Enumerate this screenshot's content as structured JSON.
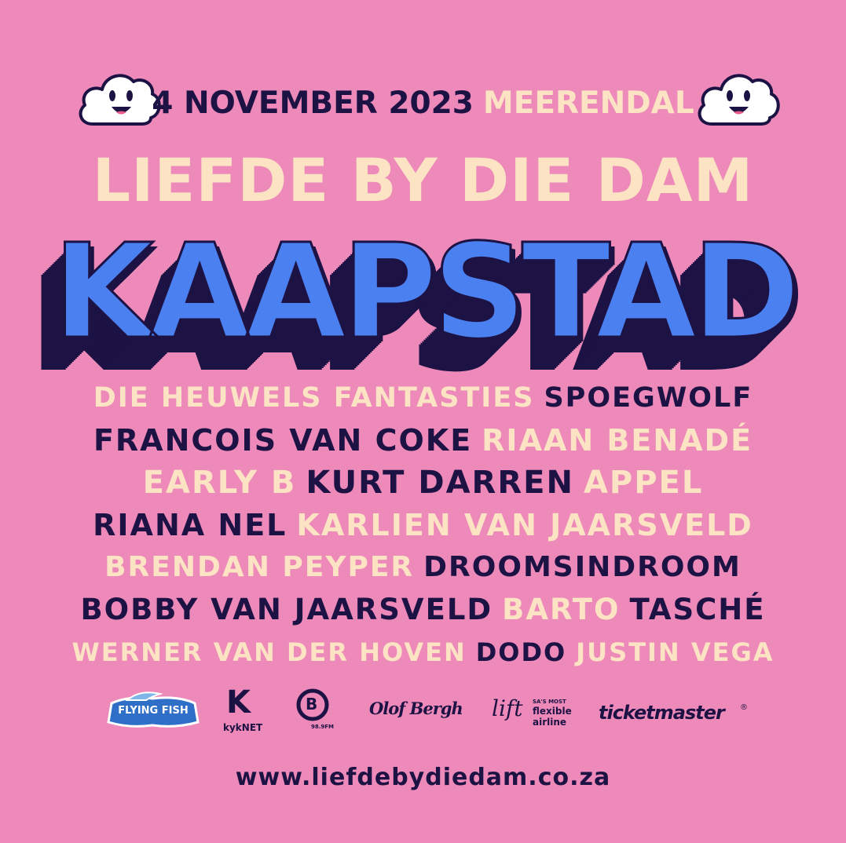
{
  "header": {
    "date": "4 NOVEMBER 2023",
    "venue": "MEERENDAL"
  },
  "title": "LIEFDE BY DIE DAM",
  "city": "KAAPSTAD",
  "lineup": [
    [
      {
        "name": "DIE HEUWELS FANTASTIES",
        "tone": "cream"
      },
      {
        "name": "SPOEGWOLF",
        "tone": "navy"
      }
    ],
    [
      {
        "name": "FRANCOIS VAN COKE",
        "tone": "navy"
      },
      {
        "name": "RIAAN BENADÉ",
        "tone": "cream"
      }
    ],
    [
      {
        "name": "EARLY B",
        "tone": "cream"
      },
      {
        "name": "KURT DARREN",
        "tone": "navy"
      },
      {
        "name": "APPEL",
        "tone": "cream"
      }
    ],
    [
      {
        "name": "RIANA NEL",
        "tone": "navy"
      },
      {
        "name": "KARLIEN VAN JAARSVELD",
        "tone": "cream"
      }
    ],
    [
      {
        "name": "BRENDAN PEYPER",
        "tone": "cream"
      },
      {
        "name": "DROOMSINDROOM",
        "tone": "navy"
      }
    ],
    [
      {
        "name": "BOBBY VAN JAARSVELD",
        "tone": "navy"
      },
      {
        "name": "BARTO",
        "tone": "cream"
      },
      {
        "name": "TASCHÉ",
        "tone": "navy"
      }
    ],
    [
      {
        "name": "WERNER VAN DER HOVEN",
        "tone": "cream"
      },
      {
        "name": "DODO",
        "tone": "navy"
      },
      {
        "name": "JUSTIN VEGA",
        "tone": "cream"
      }
    ]
  ],
  "sponsors": {
    "flying_fish": "FLYING FISH",
    "kyknet_letter": "K",
    "kyknet": "kykNET",
    "radio_letter": "B",
    "radio_freq": "98.9FM",
    "olof_bergh": "Olof Bergh",
    "lift": "lift",
    "lift_tagline_1": "SA'S MOST",
    "lift_tagline_2": "flexible",
    "lift_tagline_3": "airline",
    "ticketmaster": "ticketmaster",
    "ticketmaster_mark": "®"
  },
  "website": "www.liefdebydiedam.co.za",
  "colors": {
    "background": "#ed8ab9",
    "cream": "#fbe3c4",
    "navy": "#1d1244",
    "blue": "#4a80f0",
    "flying_fish_blue": "#2f6fc7"
  },
  "icons": [
    "smiling-cloud-icon",
    "smiling-cloud-icon"
  ]
}
